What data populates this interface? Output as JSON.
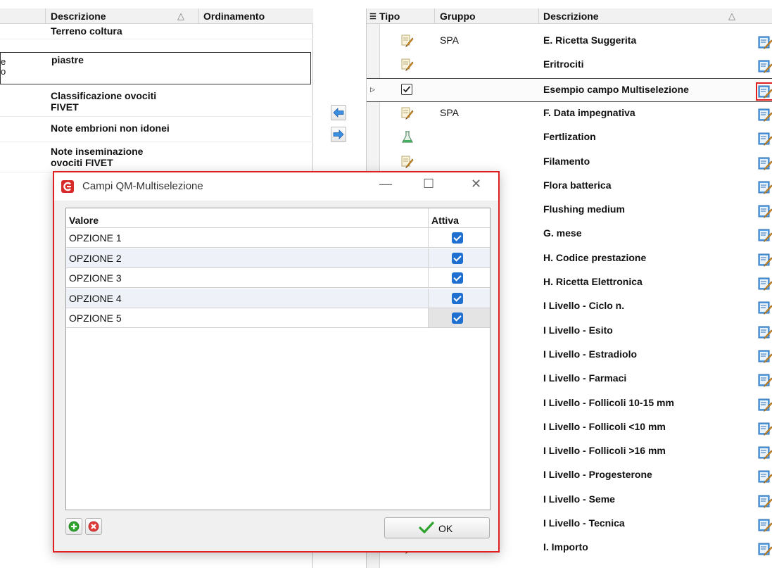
{
  "left_grid": {
    "columns": {
      "descrizione": "Descrizione",
      "sort_indicator": "△",
      "ordinamento": "Ordinamento"
    },
    "rows": [
      {
        "lines": [
          "Terreno coltura"
        ]
      },
      {
        "lines": [
          "piastre"
        ],
        "cut": [
          "e",
          "o"
        ],
        "selected": true
      },
      {
        "lines": [
          "Classificazione ovociti",
          "FIVET"
        ]
      },
      {
        "lines": [
          "Note embrioni non idonei"
        ]
      },
      {
        "lines": [
          "Note inseminazione",
          "ovociti FIVET"
        ]
      }
    ]
  },
  "arrows": {
    "left": "arrow-left",
    "right": "arrow-right"
  },
  "right_grid": {
    "columns": {
      "menu_icon": "☰",
      "tipo": "Tipo",
      "gruppo": "Gruppo",
      "descrizione": "Descrizione",
      "sort_indicator": "△"
    },
    "rows": [
      {
        "icon": "pencil-note",
        "gruppo": "SPA",
        "descrizione": "E. Ricetta Suggerita"
      },
      {
        "icon": "pencil-note",
        "gruppo": "",
        "descrizione": "Eritrociti"
      },
      {
        "icon": "checkbox",
        "gruppo": "",
        "descrizione": "Esempio campo Multiselezione",
        "selected": true
      },
      {
        "icon": "pencil-note",
        "gruppo": "SPA",
        "descrizione": "F. Data impegnativa"
      },
      {
        "icon": "flask",
        "gruppo": "",
        "descrizione": "Fertlization"
      },
      {
        "icon": "pencil-note",
        "gruppo": "",
        "descrizione": "Filamento"
      },
      {
        "icon": "pencil-note",
        "gruppo": "",
        "descrizione": "Flora batterica"
      },
      {
        "icon": "pencil-note",
        "gruppo": "",
        "descrizione": "Flushing medium"
      },
      {
        "icon": "pencil-note",
        "gruppo": "",
        "descrizione": "G. mese"
      },
      {
        "icon": "pencil-note",
        "gruppo": "",
        "descrizione": "H. Codice prestazione"
      },
      {
        "icon": "pencil-note",
        "gruppo": "",
        "descrizione": "H. Ricetta Elettronica"
      },
      {
        "icon": "pencil-note",
        "gruppo": "",
        "descrizione": "I Livello - Ciclo n."
      },
      {
        "icon": "pencil-note",
        "gruppo": "",
        "descrizione": "I Livello - Esito"
      },
      {
        "icon": "pencil-note",
        "gruppo": "",
        "descrizione": "I Livello - Estradiolo"
      },
      {
        "icon": "pencil-note",
        "gruppo": "",
        "descrizione": "I Livello - Farmaci"
      },
      {
        "icon": "pencil-note",
        "gruppo": "",
        "descrizione": "I Livello - Follicoli 10-15 mm"
      },
      {
        "icon": "pencil-note",
        "gruppo": "",
        "descrizione": "I Livello - Follicoli <10 mm"
      },
      {
        "icon": "pencil-note",
        "gruppo": "",
        "descrizione": "I Livello - Follicoli >16 mm"
      },
      {
        "icon": "pencil-note",
        "gruppo": "",
        "descrizione": "I Livello - Progesterone"
      },
      {
        "icon": "pencil-note",
        "gruppo": "",
        "descrizione": "I Livello - Seme"
      },
      {
        "icon": "pencil-note",
        "gruppo": "",
        "descrizione": "I Livello - Tecnica"
      },
      {
        "icon": "pencil-note",
        "gruppo": "",
        "descrizione": "I. Importo"
      }
    ]
  },
  "dialog": {
    "title": "Campi QM-Multiselezione",
    "controls": {
      "minimize": "—",
      "maximize": "☐",
      "close": "✕"
    },
    "table": {
      "columns": {
        "valore": "Valore",
        "attiva": "Attiva"
      },
      "rows": [
        {
          "valore": "OPZIONE 1",
          "attiva": true
        },
        {
          "valore": "OPZIONE 2",
          "attiva": true
        },
        {
          "valore": "OPZIONE 3",
          "attiva": true
        },
        {
          "valore": "OPZIONE 4",
          "attiva": true
        },
        {
          "valore": "OPZIONE 5",
          "attiva": true
        }
      ]
    },
    "buttons": {
      "ok_label": "OK",
      "ok_check": "✔"
    }
  },
  "colors": {
    "accent_red": "#e02020",
    "checkbox_blue": "#1f6fd0",
    "ok_green": "#2fa52f"
  }
}
